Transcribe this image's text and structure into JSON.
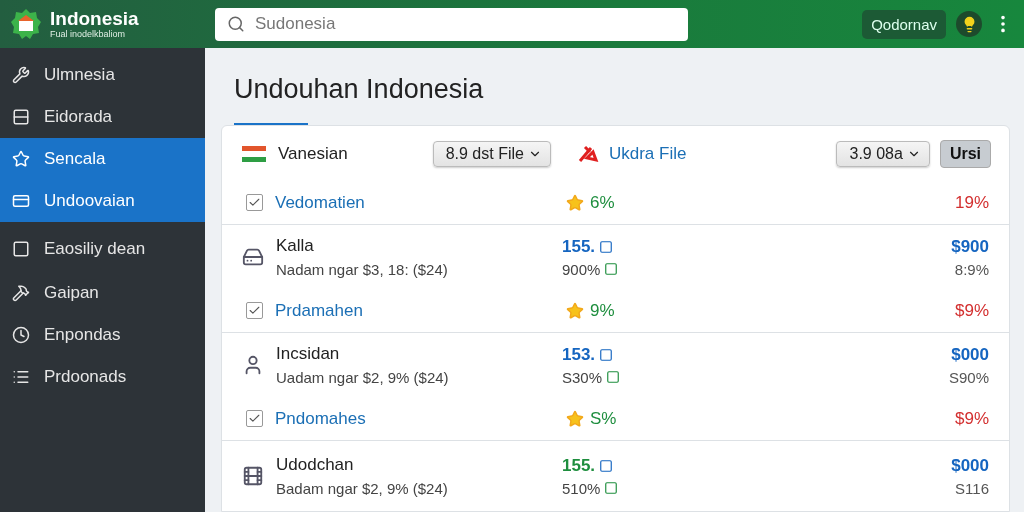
{
  "header": {
    "title": "Indonesia",
    "subtitle": "Fual inodelkbaliom",
    "search": {
      "placeholder": "Sudonesia"
    },
    "account_button": "Qodornav"
  },
  "sidebar": {
    "items": [
      {
        "label": "Ulmnesia",
        "selected": false
      },
      {
        "label": "Eidorada",
        "selected": false
      },
      {
        "label": "Sencala",
        "selected": true
      },
      {
        "label": "Undoovaian",
        "selected": true
      },
      {
        "label": "Eaosiliy dean",
        "selected": false
      },
      {
        "label": "Gaipan",
        "selected": false
      },
      {
        "label": "Enpondas",
        "selected": false
      },
      {
        "label": "Prdoonads",
        "selected": false
      }
    ]
  },
  "page": {
    "title": "Undouhan Indonesia"
  },
  "card": {
    "header": {
      "label": "Vanesian",
      "dropdown_1": "8.9 dst File",
      "link": "Ukdra File",
      "dropdown_2": "3.9 08a",
      "button": "Ursi"
    },
    "rows": [
      {
        "kind": "summary",
        "label": "Vedomatien",
        "checked": true,
        "percent": "6%",
        "change": "19%"
      },
      {
        "kind": "item",
        "name": "Kalla",
        "detail": "Nadam ngar $3, 18: ($24)",
        "value_a": "155.",
        "color": "#1565c0",
        "value_b": "900%",
        "amount": "$900",
        "note": "8:9%"
      },
      {
        "kind": "summary",
        "label": "Prdamahen",
        "checked": true,
        "percent": "9%",
        "change": "$9%"
      },
      {
        "kind": "item",
        "name": "Incsidan",
        "detail": "Uadam ngar $2, 9% ($24)",
        "value_a": "153.",
        "color": "#1565c0",
        "value_b": "S30%",
        "amount": "$000",
        "note": "S90%"
      },
      {
        "kind": "summary",
        "label": "Pndomahes",
        "checked": true,
        "percent": "S%",
        "change": "$9%"
      },
      {
        "kind": "item",
        "name": "Udodchan",
        "detail": "Badam ngar $2, 9% ($24)",
        "value_a": "155.",
        "color": "#1e8e3e",
        "value_b": "510%",
        "amount": "$000",
        "note": "S116"
      }
    ]
  }
}
